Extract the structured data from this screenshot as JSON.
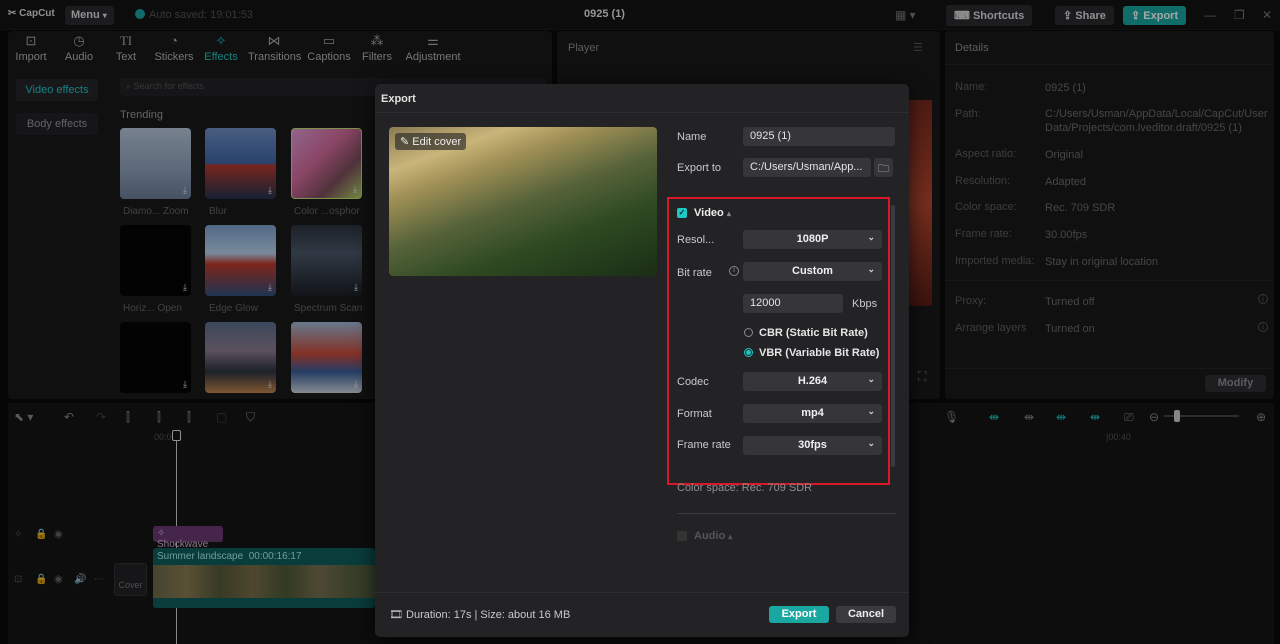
{
  "app": {
    "logo": "CapCut",
    "menu_label": "Menu",
    "autosave": "Auto saved: 19:01:53",
    "project_title": "0925 (1)",
    "shortcuts_label": "Shortcuts",
    "share_label": "Share",
    "export_label": "Export"
  },
  "toolbar": {
    "items": [
      {
        "label": "Import",
        "icon": "import-icon"
      },
      {
        "label": "Audio",
        "icon": "audio-icon"
      },
      {
        "label": "Text",
        "icon": "text-icon"
      },
      {
        "label": "Stickers",
        "icon": "stickers-icon"
      },
      {
        "label": "Effects",
        "icon": "effects-icon"
      },
      {
        "label": "Transitions",
        "icon": "transitions-icon"
      },
      {
        "label": "Captions",
        "icon": "captions-icon"
      },
      {
        "label": "Filters",
        "icon": "filters-icon"
      },
      {
        "label": "Adjustment",
        "icon": "adjustment-icon"
      }
    ]
  },
  "effects_panel": {
    "sidebar": [
      "Video effects",
      "Body effects"
    ],
    "search_placeholder": "Search for effects",
    "section": "Trending",
    "items": [
      "Diamo... Zoom",
      "Blur",
      "Color ...osphor",
      "Horiz... Open",
      "Edge Glow",
      "Spectrum Scan",
      "",
      "",
      ""
    ]
  },
  "player": {
    "title": "Player"
  },
  "details": {
    "title": "Details",
    "rows": [
      {
        "key": "Name:",
        "value": "0925 (1)"
      },
      {
        "key": "Path:",
        "value": "C:/Users/Usman/AppData/Local/CapCut/User Data/Projects/com.lveditor.draft/0925 (1)"
      },
      {
        "key": "Aspect ratio:",
        "value": "Original"
      },
      {
        "key": "Resolution:",
        "value": "Adapted"
      },
      {
        "key": "Color space:",
        "value": "Rec. 709 SDR"
      },
      {
        "key": "Frame rate:",
        "value": "30.00fps"
      },
      {
        "key": "Imported media:",
        "value": "Stay in original location"
      },
      {
        "key": "Proxy:",
        "value": "Turned off"
      },
      {
        "key": "Arrange layers",
        "value": "Turned on"
      }
    ],
    "modify_label": "Modify"
  },
  "timeline": {
    "time_start": "00:00",
    "time_end": "|00:40",
    "effect_clip": "Shockwave",
    "video_clip_name": "Summer landscape",
    "video_clip_duration": "00:00:16:17",
    "cover_label": "Cover"
  },
  "export_dialog": {
    "title": "Export",
    "edit_cover": "Edit cover",
    "name_label": "Name",
    "name_value": "0925 (1)",
    "export_to_label": "Export to",
    "export_to_value": "C:/Users/Usman/App...",
    "video_section": "Video",
    "resolution_label": "Resol...",
    "resolution_value": "1080P",
    "bitrate_label": "Bit rate",
    "bitrate_value": "Custom",
    "bitrate_kbps": "12000",
    "kbps_unit": "Kbps",
    "cbr_label": "CBR (Static Bit Rate)",
    "vbr_label": "VBR (Variable Bit Rate)",
    "vbr_selected": true,
    "codec_label": "Codec",
    "codec_value": "H.264",
    "format_label": "Format",
    "format_value": "mp4",
    "framerate_label": "Frame rate",
    "framerate_value": "30fps",
    "color_space": "Color space: Rec. 709 SDR",
    "audio_section": "Audio",
    "footer_info": "Duration: 17s | Size: about 16 MB",
    "export_button": "Export",
    "cancel_button": "Cancel"
  },
  "colors": {
    "accent": "#1fc8c4",
    "export_btn": "#1aa7a2",
    "highlight_box": "#d8192a"
  }
}
